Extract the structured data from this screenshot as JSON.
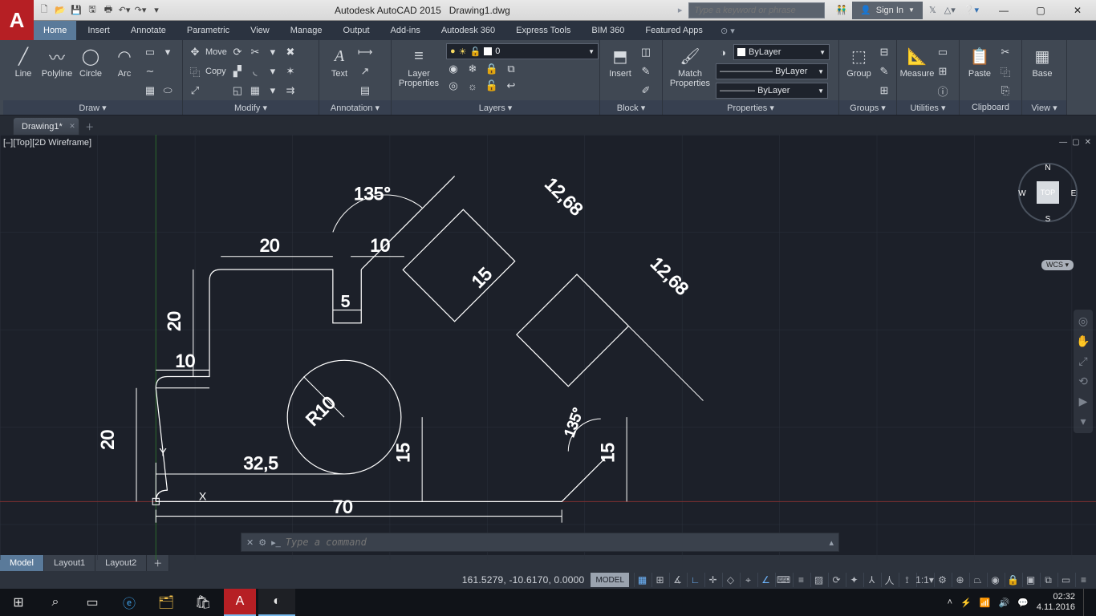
{
  "titlebar": {
    "app": "Autodesk AutoCAD 2015",
    "doc": "Drawing1.dwg",
    "search_placeholder": "Type a keyword or phrase",
    "signin": "Sign In"
  },
  "ribbon_tabs": [
    "Home",
    "Insert",
    "Annotate",
    "Parametric",
    "View",
    "Manage",
    "Output",
    "Add-ins",
    "Autodesk 360",
    "Express Tools",
    "BIM 360",
    "Featured Apps"
  ],
  "ribbon_active": 0,
  "panels": {
    "draw": {
      "title": "Draw ▾",
      "items": [
        "Line",
        "Polyline",
        "Circle",
        "Arc"
      ]
    },
    "modify": {
      "title": "Modify ▾",
      "move": "Move",
      "copy": "Copy"
    },
    "annotation": {
      "title": "Annotation ▾",
      "text": "Text"
    },
    "layers": {
      "title": "Layers ▾",
      "btn": "Layer\nProperties",
      "current": "0"
    },
    "block": {
      "title": "Block ▾",
      "btn": "Insert"
    },
    "properties": {
      "title": "Properties ▾",
      "btn": "Match\nProperties",
      "color": "ByLayer",
      "lw": "ByLayer",
      "lt": "ByLayer"
    },
    "groups": {
      "title": "Groups ▾",
      "btn": "Group"
    },
    "utilities": {
      "title": "Utilities ▾",
      "btn": "Measure"
    },
    "clipboard": {
      "title": "Clipboard",
      "btn": "Paste"
    },
    "view": {
      "title": "View ▾",
      "btn": "Base"
    }
  },
  "doc_tabs": {
    "active": "Drawing1*"
  },
  "viewport": {
    "label": "[–][Top][2D Wireframe]",
    "cube": "TOP",
    "wcs": "WCS ▾"
  },
  "cmd": {
    "placeholder": "Type a command"
  },
  "layout_tabs": [
    "Model",
    "Layout1",
    "Layout2"
  ],
  "status": {
    "coords": "161.5279, -10.6170, 0.0000",
    "mode": "MODEL",
    "scale": "1:1"
  },
  "taskbar": {
    "time": "02:32",
    "date": "4.11.2016"
  },
  "drawing": {
    "dims": {
      "d135a": "135°",
      "d20a": "20",
      "d10a": "10",
      "d1268a": "12,68",
      "d15a": "15",
      "d1268b": "12,68",
      "d5": "5",
      "d20b": "20",
      "d10b": "10",
      "d20c": "20",
      "r10": "R10",
      "d325": "32,5",
      "d15b": "15",
      "d135b": "135°",
      "d15c": "15",
      "d70": "70"
    },
    "axes": {
      "x": "X",
      "y": "Y"
    }
  }
}
